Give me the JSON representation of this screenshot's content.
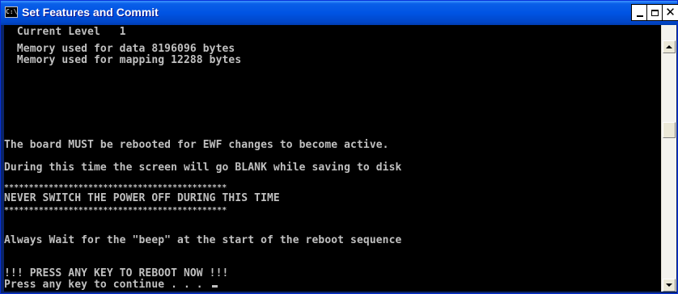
{
  "window": {
    "title": "Set Features and Commit",
    "icon_label": "C:\\",
    "controls": {
      "minimize": "minimize-icon",
      "maximize": "maximize-icon",
      "close": "✕"
    }
  },
  "console": {
    "lines": [
      "  Current Level   1",
      "  Memory used for data 8196096 bytes",
      "  Memory used for mapping 12288 bytes",
      "The board MUST be rebooted for EWF changes to become active.",
      "During this time the screen will go BLANK while saving to disk",
      "*********************************************",
      "NEVER SWITCH THE POWER OFF DURING THIS TIME",
      "*********************************************",
      "Always Wait for the \"beep\" at the start of the reboot sequence",
      "!!! PRESS ANY KEY TO REBOOT NOW !!!",
      "Press any key to continue . . . "
    ],
    "colors": {
      "background": "#000000",
      "text": "#c0c0c0"
    }
  },
  "scrollbar": {
    "up_icon": "arrow-up-icon",
    "down_icon": "arrow-down-icon"
  }
}
